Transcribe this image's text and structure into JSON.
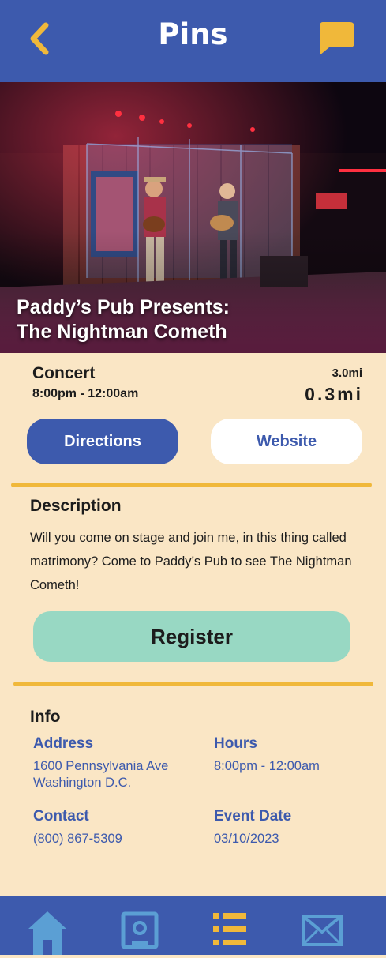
{
  "header": {
    "title": "Pins",
    "back_icon": "chevron-left-icon",
    "chat_icon": "chat-bubble-icon"
  },
  "event": {
    "title_line1": "Paddy’s Pub Presents:",
    "title_line2": "The Nightman Cometh",
    "type": "Concert",
    "time": "8:00pm - 12:00am",
    "distance_small": "3.0mi",
    "distance_large": "0.3mi"
  },
  "actions": {
    "directions_label": "Directions",
    "website_label": "Website",
    "register_label": "Register"
  },
  "description": {
    "heading": "Description",
    "text": "Will you come on stage and join me, in this thing called matrimony? Come to Paddy’s Pub to see The Nightman Cometh!"
  },
  "info": {
    "heading": "Info",
    "address_label": "Address",
    "address_line1": "1600 Pennsylvania Ave",
    "address_line2": "Washington D.C.",
    "hours_label": "Hours",
    "hours_value": "8:00pm - 12:00am",
    "contact_label": "Contact",
    "contact_value": "(800) 867-5309",
    "date_label": "Event Date",
    "date_value": "03/10/2023"
  },
  "tabs": [
    {
      "icon": "home-icon"
    },
    {
      "icon": "map-pin-icon"
    },
    {
      "icon": "list-icon"
    },
    {
      "icon": "mail-icon"
    }
  ],
  "colors": {
    "primary": "#3d5aad",
    "accent": "#f0b83a",
    "background": "#fae6c5",
    "register": "#98d8c3",
    "inactive_tab": "#5b9fd4"
  }
}
